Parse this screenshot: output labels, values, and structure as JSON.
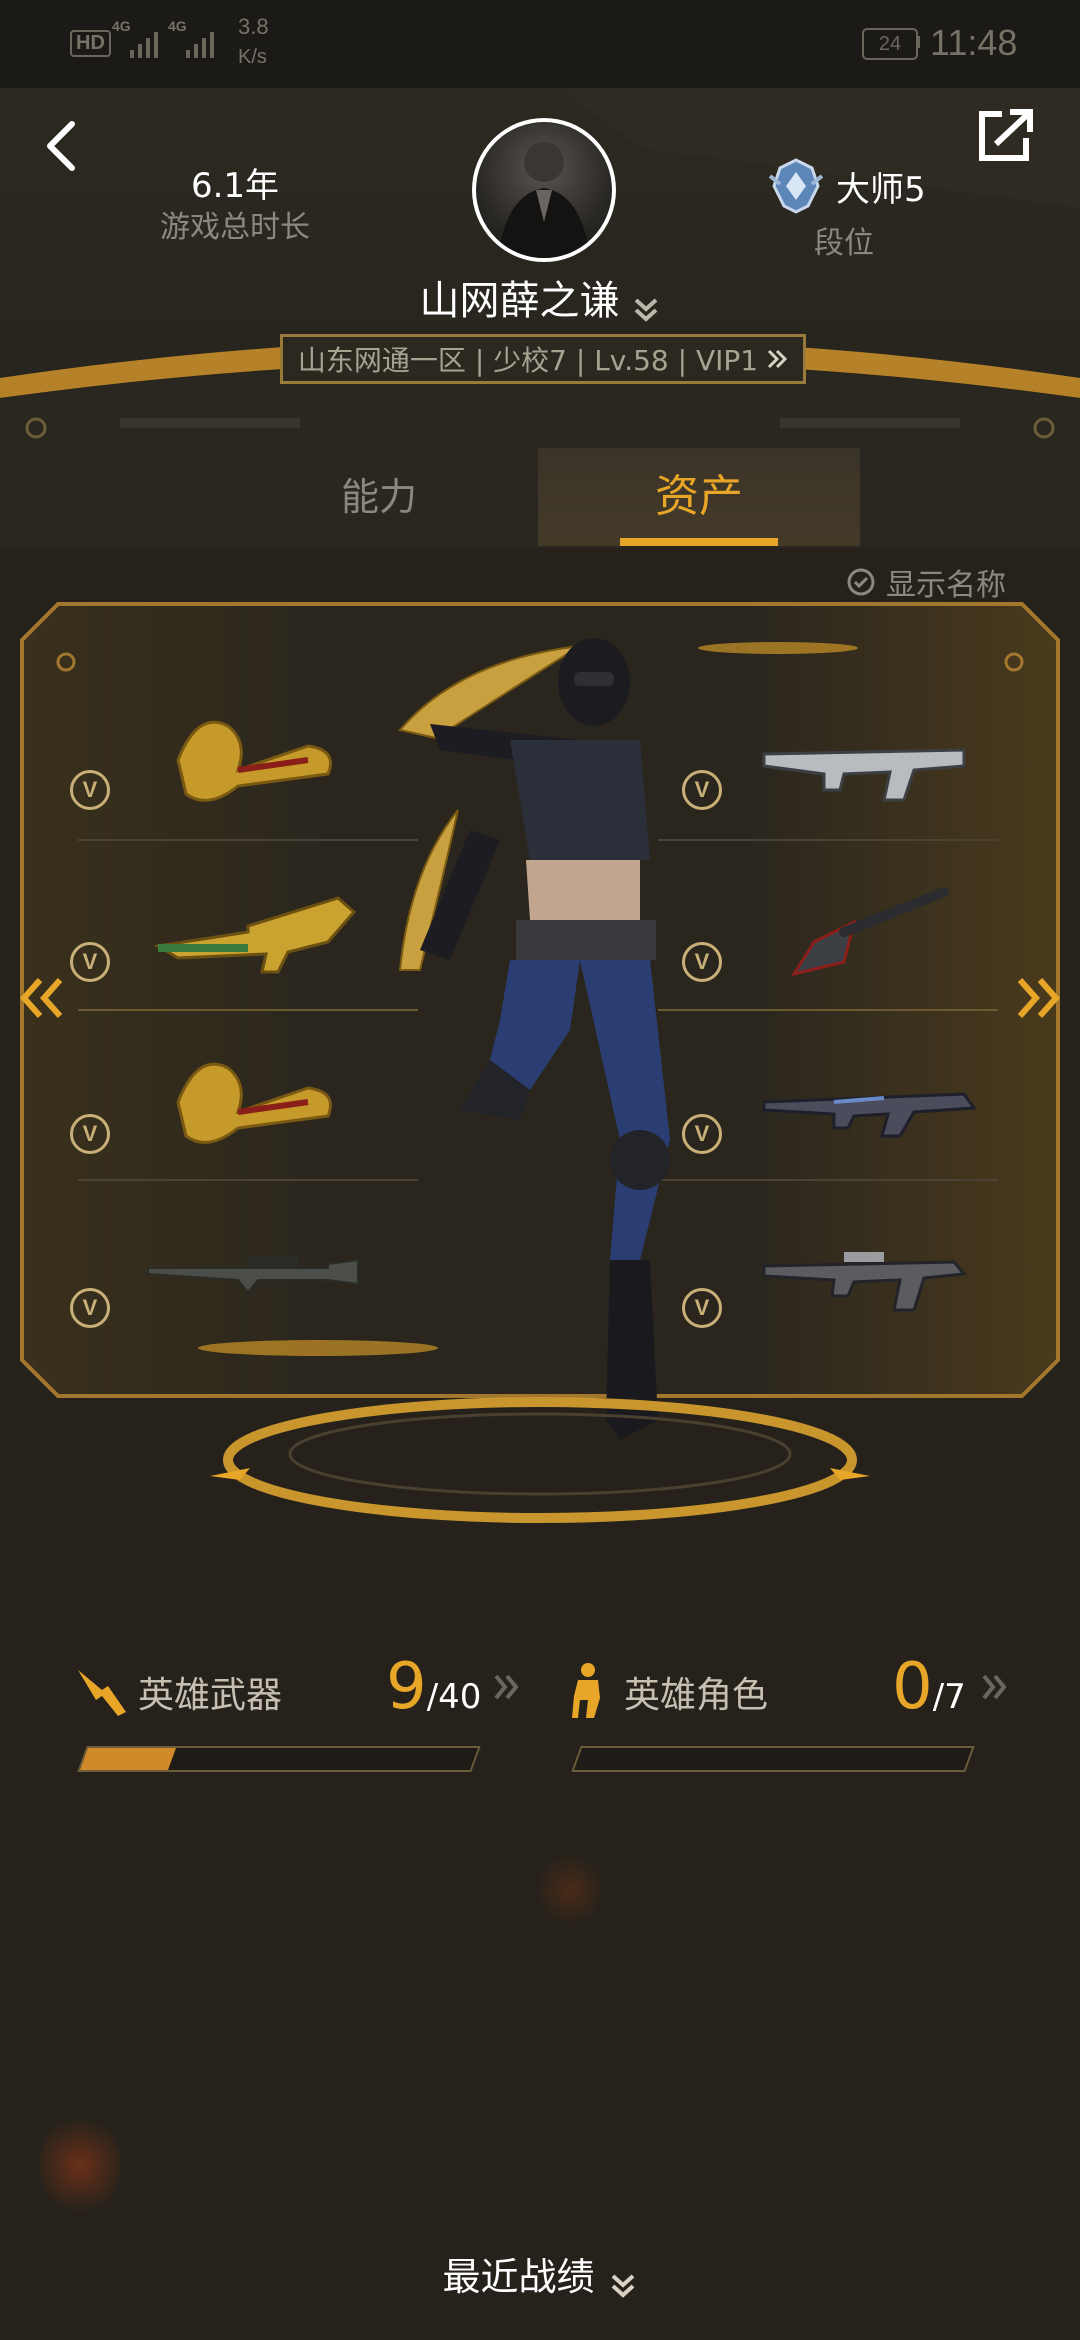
{
  "status_bar": {
    "hd": "HD",
    "net1": "4G",
    "net2": "4G",
    "speed_value": "3.8",
    "speed_unit": "K/s",
    "battery": "24",
    "time": "11:48"
  },
  "profile": {
    "play_time_value": "6.1年",
    "play_time_label": "游戏总时长",
    "name": "山网薛之谦",
    "rank_title": "大师5",
    "rank_label": "段位",
    "info_bar": "山东网通一区 | 少校7 | Lv.58 |  VIP1"
  },
  "tabs": [
    {
      "label": "能力",
      "active": false
    },
    {
      "label": "资产",
      "active": true
    }
  ],
  "show_names_label": "显示名称",
  "stats": {
    "weapons": {
      "label": "英雄武器",
      "count": "9",
      "total": "/40",
      "progress": 0.225
    },
    "roles": {
      "label": "英雄角色",
      "count": "0",
      "total": "/7",
      "progress": 0
    }
  },
  "recent_label": "最近战绩",
  "icons": {
    "back": "chevron-left-icon",
    "share": "share-external-icon",
    "expand": "chevron-double-down-icon",
    "check": "check-circle-icon",
    "rank": "rank-emblem-icon",
    "vip": "v-badge-icon"
  },
  "colors": {
    "accent": "#e8a628",
    "background": "#26221b",
    "text_muted": "#8d887e"
  }
}
